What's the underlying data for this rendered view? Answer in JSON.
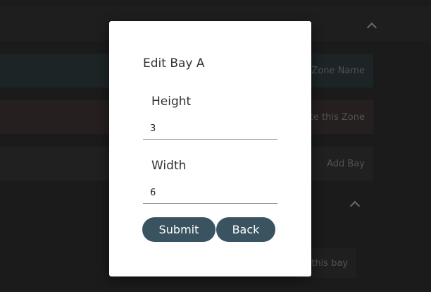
{
  "background": {
    "rows": [
      {
        "label": "t Zone Name",
        "bg": "#20292b"
      },
      {
        "label": "ete this Zone",
        "bg": "#2b2424"
      },
      {
        "label": "Add Bay",
        "bg": "#252525"
      },
      {
        "label": "f this bay",
        "bg": "#242424"
      }
    ]
  },
  "modal": {
    "title": "Edit Bay A",
    "height_label": "Height",
    "height_value": "3",
    "width_label": "Width",
    "width_value": "6",
    "submit_label": "Submit",
    "back_label": "Back"
  },
  "colors": {
    "button": "#3a5361",
    "modal_bg": "#ffffff",
    "backdrop": "#1f1f1f"
  },
  "icons": {
    "collapse_top": "chevron-up-icon",
    "collapse_bay": "chevron-up-icon"
  }
}
